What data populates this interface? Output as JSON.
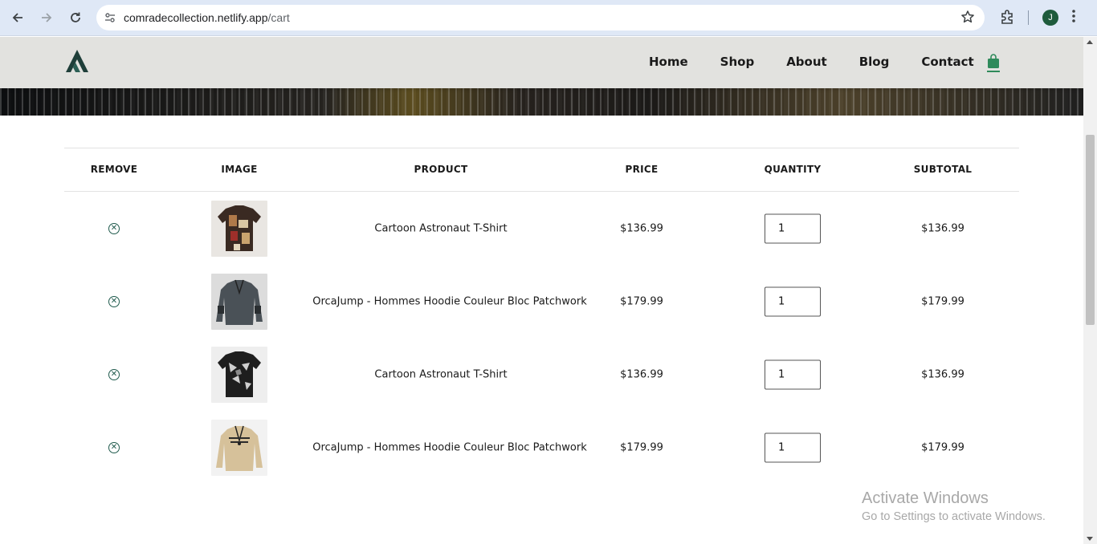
{
  "browser": {
    "url_host": "comradecollection.netlify.app",
    "url_path": "/cart",
    "avatar_initial": "J",
    "icons": [
      "back-arrow-icon",
      "forward-arrow-icon",
      "reload-icon",
      "site-settings-icon",
      "bookmark-star-icon",
      "extensions-icon",
      "kebab-menu-icon"
    ]
  },
  "header": {
    "nav": [
      "Home",
      "Shop",
      "About",
      "Blog",
      "Contact"
    ],
    "accent_color": "#2f8a5b"
  },
  "cart": {
    "headers": [
      "REMOVE",
      "IMAGE",
      "PRODUCT",
      "PRICE",
      "QUANTITY",
      "SUBTOTAL"
    ],
    "items": [
      {
        "product": "Cartoon Astronaut T-Shirt",
        "price": "$136.99",
        "quantity": "1",
        "subtotal": "$136.99",
        "image": "patchwork-shirt-brown"
      },
      {
        "product": "OrcaJump - Hommes Hoodie Couleur Bloc Patchwork",
        "price": "$179.99",
        "quantity": "1",
        "subtotal": "$179.99",
        "image": "gray-sweatshirt"
      },
      {
        "product": "Cartoon Astronaut T-Shirt",
        "price": "$136.99",
        "quantity": "1",
        "subtotal": "$136.99",
        "image": "black-gray-print-shirt"
      },
      {
        "product": "OrcaJump - Hommes Hoodie Couleur Bloc Patchwork",
        "price": "$179.99",
        "quantity": "1",
        "subtotal": "$179.99",
        "image": "beige-sweatshirt"
      }
    ]
  },
  "watermark": {
    "title": "Activate Windows",
    "subtitle": "Go to Settings to activate Windows."
  }
}
